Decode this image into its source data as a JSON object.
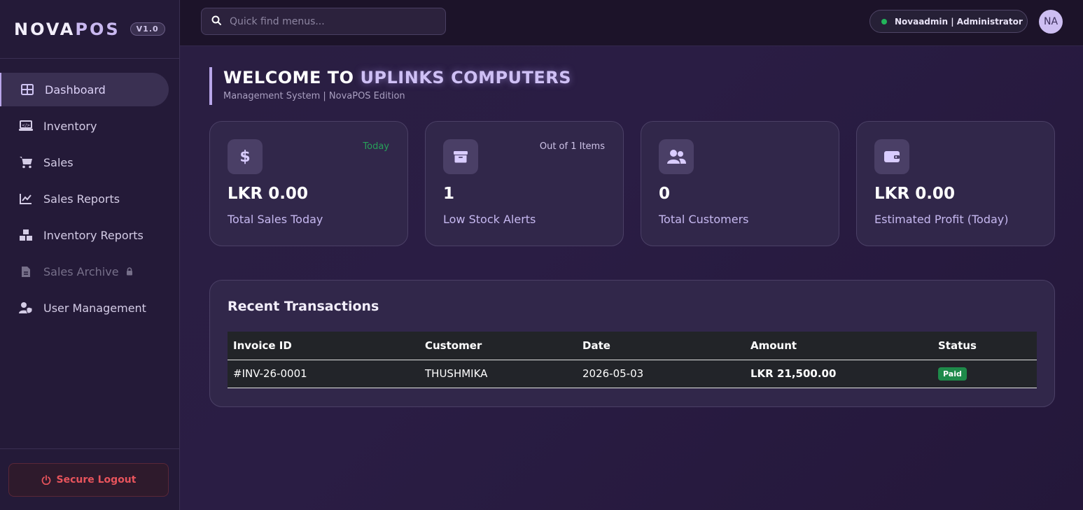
{
  "brand": {
    "name_main": "NOVA",
    "name_accent": "POS",
    "version": "V1.0"
  },
  "nav": {
    "items": [
      {
        "label": "Dashboard",
        "icon": "grid-icon",
        "active": true
      },
      {
        "label": "Inventory",
        "icon": "laptop-icon"
      },
      {
        "label": "Sales",
        "icon": "cart-icon"
      },
      {
        "label": "Sales Reports",
        "icon": "chart-line-icon"
      },
      {
        "label": "Inventory Reports",
        "icon": "boxes-icon"
      },
      {
        "label": "Sales Archive",
        "icon": "file-icon",
        "disabled": true,
        "locked": true
      },
      {
        "label": "User Management",
        "icon": "user-shield-icon"
      }
    ]
  },
  "logout": {
    "label": "Secure Logout"
  },
  "search": {
    "placeholder": "Quick find menus..."
  },
  "user": {
    "label": "Novaadmin | Administrator",
    "initials": "NA",
    "status_color": "#22b45a"
  },
  "welcome": {
    "title_prefix": "WELCOME TO ",
    "title_highlight": "UPLINKS COMPUTERS",
    "subtitle": "Management System | NovaPOS Edition"
  },
  "cards": [
    {
      "icon": "dollar-icon",
      "tag": "Today",
      "tag_color": "#27a05a",
      "value": "LKR 0.00",
      "label": "Total Sales Today"
    },
    {
      "icon": "box-icon",
      "tag": "Out of 1 Items",
      "tag_color": "#cfc4e8",
      "value": "1",
      "label": "Low Stock Alerts"
    },
    {
      "icon": "users-icon",
      "tag": "",
      "value": "0",
      "label": "Total Customers"
    },
    {
      "icon": "wallet-icon",
      "tag": "",
      "value": "LKR 0.00",
      "label": "Estimated Profit (Today)"
    }
  ],
  "transactions": {
    "title": "Recent Transactions",
    "columns": [
      "Invoice ID",
      "Customer",
      "Date",
      "Amount",
      "Status"
    ],
    "rows": [
      {
        "invoice": "#INV-26-0001",
        "customer": "THUSHMIKA",
        "date": "2026-05-03",
        "amount": "LKR 21,500.00",
        "status": "Paid"
      }
    ]
  }
}
